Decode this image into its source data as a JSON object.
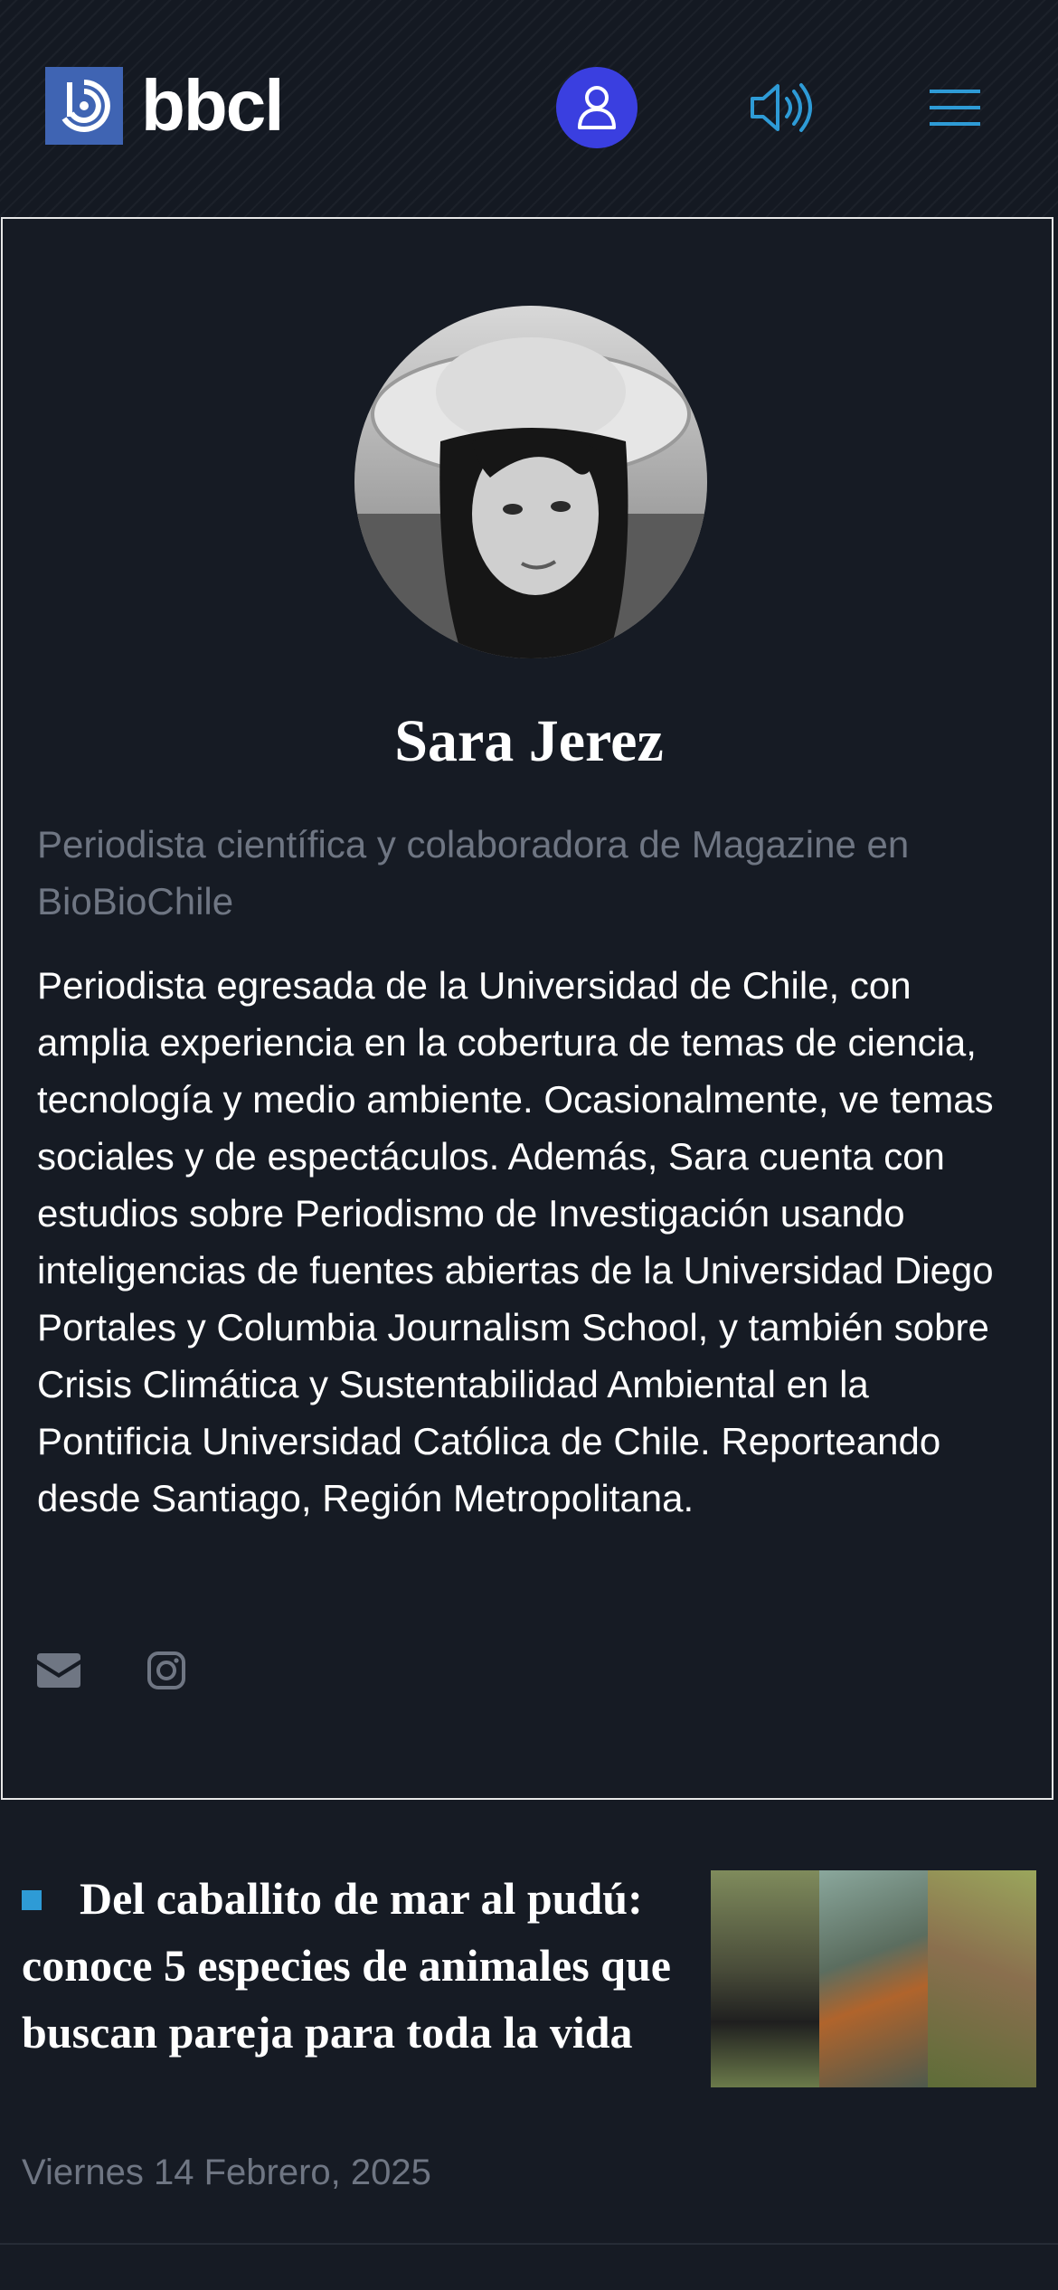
{
  "header": {
    "logo_text": "bbcl",
    "icons": {
      "logo": "bbcl-logo-icon",
      "user": "user-icon",
      "audio": "speaker-icon",
      "menu": "menu-icon"
    },
    "colors": {
      "user_button": "#3a3fe0",
      "accent": "#2e9bd6",
      "logo_square": "#3f64b3"
    }
  },
  "profile": {
    "name": "Sara Jerez",
    "role": "Periodista científica y colaboradora de Magazine en BioBioChile",
    "bio": "Periodista egresada de la Universidad de Chile, con amplia experiencia en la cobertura de temas de ciencia, tecnología y medio ambiente. Ocasionalmente, ve temas sociales y de espectáculos. Además, Sara cuenta con estudios sobre Periodismo de Investigación usando inteligencias de fuentes abiertas de la Universidad Diego Portales y Columbia Journalism School, y también sobre Crisis Climática y Sustentabilidad Ambiental en la Pontificia Universidad Católica de Chile. Reporteando desde Santiago, Región Metropolitana.",
    "social_icons": [
      "email-icon",
      "instagram-icon"
    ]
  },
  "articles": [
    {
      "title": "Del caballito de mar al pudú: conoce 5 especies de animales que buscan pareja para toda la vida",
      "date": "Viernes 14 Febrero, 2025"
    }
  ]
}
